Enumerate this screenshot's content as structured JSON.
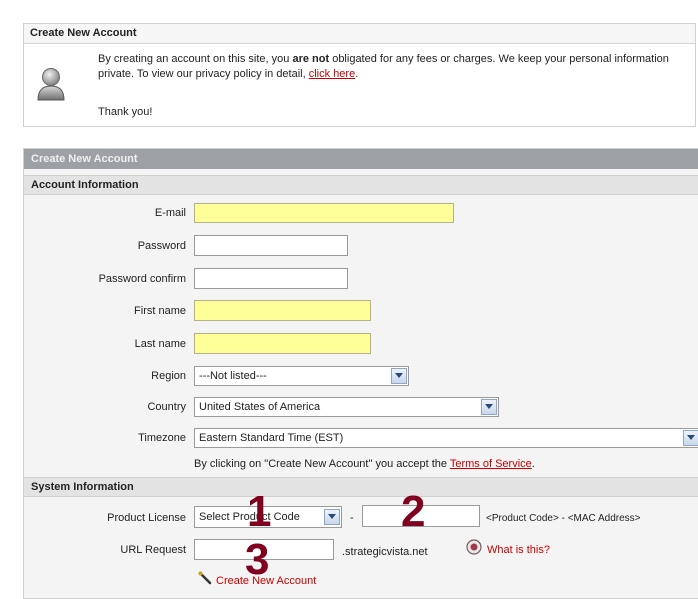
{
  "notice": {
    "title": "Create New Account",
    "text_before": "By creating an account on this site, you ",
    "text_bold": "are not",
    "text_after": " obligated for any fees or charges.  We keep your personal information private.  To view our privacy policy in detail, ",
    "link": "click here",
    "text_end": ".",
    "thanks": "Thank you!"
  },
  "form": {
    "title": "Create New Account",
    "account_section": "Account Information",
    "email_label": "E-mail",
    "email_value": "",
    "password_label": "Password",
    "password_confirm_label": "Password confirm",
    "first_name_label": "First name",
    "last_name_label": "Last name",
    "region_label": "Region",
    "region_value": "---Not listed---",
    "country_label": "Country",
    "country_value": "United States of America",
    "timezone_label": "Timezone",
    "timezone_value": "Eastern Standard Time (EST)",
    "tos_before": "By clicking on \"Create New Account\" you accept the ",
    "tos_link": "Terms of Service",
    "tos_after": ".",
    "system_section": "System Information",
    "license_label": "Product License",
    "license_value": "Select Product Code",
    "license_dash": "-",
    "license_hint": "<Product Code> - <MAC Address>",
    "url_label": "URL Request",
    "url_suffix": ".strategicvista.net",
    "what_is_this": "What is this?",
    "submit_label": "Create New Account"
  },
  "callouts": [
    "1",
    "2",
    "3"
  ],
  "colors": {
    "required_bg": "#ffff99",
    "link": "#cc0000",
    "title_bar": "#9da0a4",
    "callout": "#800020"
  }
}
